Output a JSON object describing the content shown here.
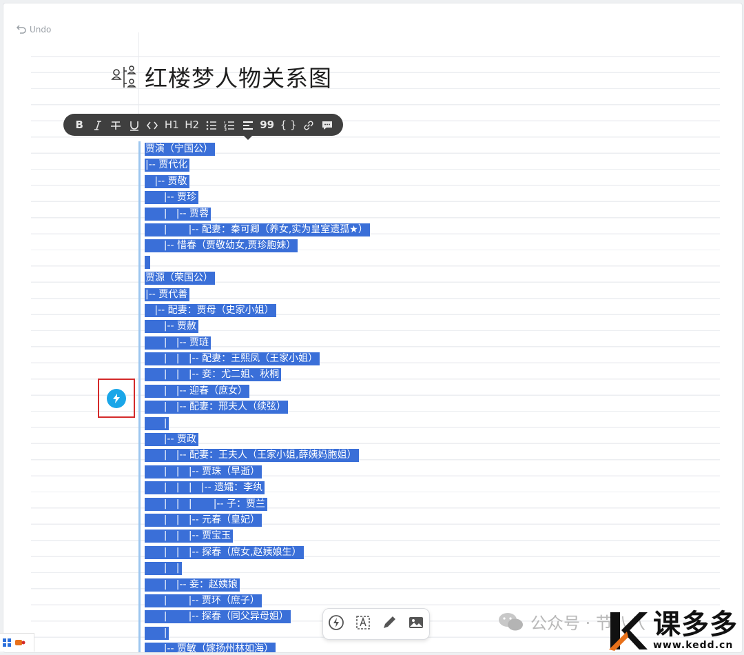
{
  "header": {
    "undo_label": "Undo"
  },
  "page": {
    "title": "红楼梦人物关系图"
  },
  "toolbar": {
    "bold": "B",
    "h1": "H1",
    "h2": "H2",
    "quote": "99",
    "code_block": "{ }"
  },
  "code_lines": [
    "贾演（宁国公）",
    "|-- 贾代化",
    "   |-- 贾敬",
    "      |-- 贾珍",
    "      |   |-- 贾蓉",
    "      |       |-- 配妻：秦可卿（养女,实为皇室遗孤★）",
    "      |-- 惜春（贾敬幼女,贾珍胞妹）",
    "",
    "贾源（荣国公）",
    "|-- 贾代善",
    "   |-- 配妻：贾母（史家小姐）",
    "      |-- 贾赦",
    "      |   |-- 贾琏",
    "      |   |   |-- 配妻：王熙凤（王家小姐）",
    "      |   |   |-- 妾：尤二姐、秋桐",
    "      |   |-- 迎春（庶女）",
    "      |   |-- 配妻：邢夫人（续弦）",
    "      |",
    "      |-- 贾政",
    "      |   |-- 配妻：王夫人（王家小姐,薛姨妈胞姐）",
    "      |   |   |-- 贾珠（早逝）",
    "      |   |   |   |-- 遗孀：李纨",
    "      |   |   |       |-- 子：贾兰",
    "      |   |   |-- 元春（皇妃）",
    "      |   |   |-- 贾宝玉",
    "      |   |   |-- 探春（庶女,赵姨娘生）",
    "      |   |",
    "      |   |-- 妾：赵姨娘",
    "      |       |-- 贾环（庶子）",
    "      |       |-- 探春（同父异母姐）",
    "      |",
    "      |-- 贾敏（嫁扬州林如海）"
  ],
  "watermark": {
    "text": "公众号 · 节八八"
  },
  "logo": {
    "name": "课多多",
    "url": "www.kedd.cn"
  },
  "colors": {
    "selection": "#3a6fd8",
    "toolbar_bg": "#3f3f3f",
    "accent": "#1aa6e8",
    "highlight_box": "#d42a2a"
  }
}
